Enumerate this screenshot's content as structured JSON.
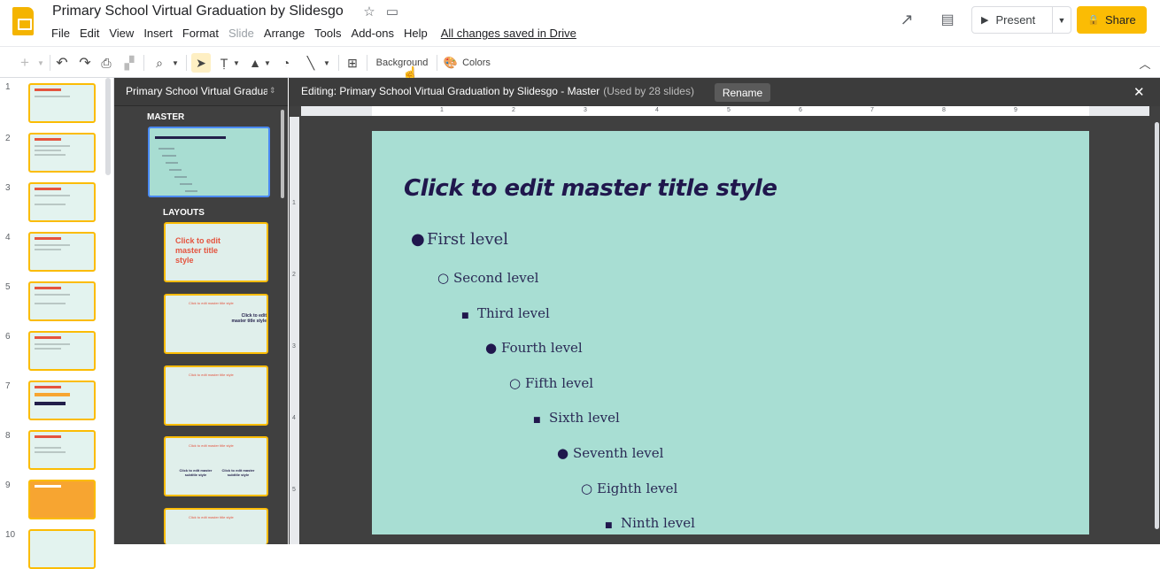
{
  "header": {
    "doc_title": "Primary School Virtual Graduation by Slidesgo",
    "menus": [
      "File",
      "Edit",
      "View",
      "Insert",
      "Format",
      "Slide",
      "Arrange",
      "Tools",
      "Add-ons",
      "Help"
    ],
    "saved_status": "All changes saved in Drive",
    "present_label": "Present",
    "share_label": "Share"
  },
  "toolbar": {
    "background_label": "Background",
    "colors_label": "Colors"
  },
  "filmstrip": {
    "numbers": [
      "1",
      "2",
      "3",
      "4",
      "5",
      "6",
      "7",
      "8",
      "9",
      "10"
    ]
  },
  "master_panel": {
    "title": "Primary School Virtual Graduation by Slidesgo",
    "master_label": "MASTER",
    "layouts_label": "LAYOUTS",
    "layout1_text": "Click to edit master title style",
    "layout_small_title": "Click to edit master title style",
    "layout2_right": "Click to edit master title style",
    "layout4_left": "Click to edit master subtitle style",
    "layout4_right": "Click to edit master subtitle style"
  },
  "editor": {
    "title": "Editing: Primary School Virtual Graduation by Slidesgo - Master",
    "used_by": "(Used by 28 slides)",
    "rename_label": "Rename",
    "ruler_numbers": [
      "1",
      "2",
      "3",
      "4",
      "5",
      "6",
      "7",
      "8",
      "9"
    ],
    "ruler_left_numbers": [
      "1",
      "2",
      "3",
      "4",
      "5"
    ]
  },
  "slide": {
    "title": "Click to edit master title style",
    "levels": [
      "First level",
      "Second level",
      "Third level",
      "Fourth level",
      "Fifth level",
      "Sixth level",
      "Seventh level",
      "Eighth level",
      "Ninth level"
    ],
    "bullets": [
      "●",
      "○",
      "■",
      "●",
      "○",
      "■",
      "●",
      "○",
      "■"
    ],
    "background_color": "#a8ded3",
    "title_color": "#20174d"
  },
  "colors": {
    "accent": "#fbbc04",
    "selection": "#4a8af4"
  }
}
